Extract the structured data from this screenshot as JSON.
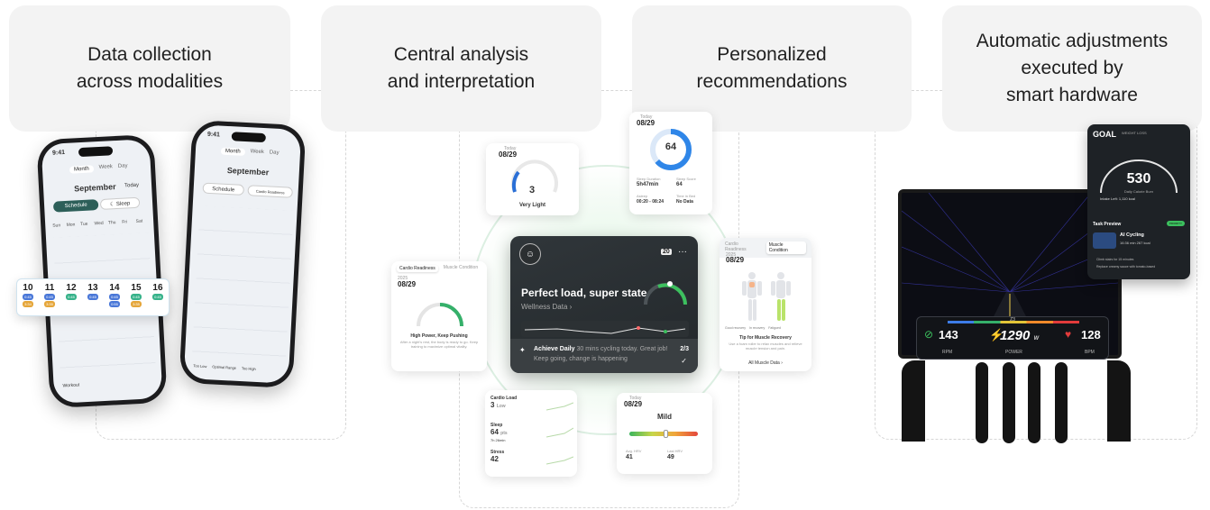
{
  "stages": [
    {
      "line1": "Data collection",
      "line2": "across modalities",
      "line3": ""
    },
    {
      "line1": "Central analysis",
      "line2": "and interpretation",
      "line3": ""
    },
    {
      "line1": "Personalized",
      "line2": "recommendations",
      "line3": ""
    },
    {
      "line1": "Automatic adjustments",
      "line2": "executed by",
      "line3": "smart hardware"
    }
  ],
  "phone_left": {
    "time": "9:41",
    "tabs": [
      "Month",
      "Week",
      "Day"
    ],
    "month": "September",
    "today": "Today",
    "schedule": "Schedule",
    "sleep": "Sleep",
    "days": [
      "Sun",
      "Mon",
      "Tue",
      "Wed",
      "Thu",
      "Fri",
      "Sat"
    ],
    "workout": "Workout"
  },
  "phone_right": {
    "time": "9:41",
    "tabs": [
      "Month",
      "Week",
      "Day"
    ],
    "month": "September",
    "schedule": "Schedule",
    "metric": "Cardio Readiness",
    "legend": [
      "Too Low",
      "Optimal Range",
      "Too High"
    ]
  },
  "week_strip": {
    "days": [
      {
        "num": "10",
        "tag1": "0:45",
        "tag2": "3:34"
      },
      {
        "num": "11",
        "tag1": "0:45",
        "tag2": "3:35"
      },
      {
        "num": "12",
        "tag1": "0:45",
        "tag2": ""
      },
      {
        "num": "13",
        "tag1": "0:45",
        "tag2": ""
      },
      {
        "num": "14",
        "tag1": "0:45",
        "tag2": "0:55"
      },
      {
        "num": "15",
        "tag1": "0:45",
        "tag2": "3:35"
      },
      {
        "num": "16",
        "tag1": "0:45",
        "tag2": ""
      }
    ]
  },
  "card_strain": {
    "date": "08/29",
    "value": "3",
    "label": "Very Light",
    "today": "Today"
  },
  "card_score": {
    "date": "08/29",
    "value": "64",
    "today": "Today",
    "stats": [
      {
        "label": "Sleep Duration",
        "value": "5h47min"
      },
      {
        "label": "Sleep Score",
        "value": "64"
      },
      {
        "label": "Asleep",
        "value": "00:20 - 08:24"
      },
      {
        "label": "Time in Bed",
        "value": "No Data"
      }
    ]
  },
  "card_cardio": {
    "tab1": "Cardio Readiness",
    "tab2": "Muscle Condition",
    "year": "2025",
    "date": "08/29",
    "title": "High Power, Keep Pushing",
    "body": "After a night's rest, the body is ready to go. Keep training to maximize optimal vitality."
  },
  "main_card": {
    "day": "20",
    "headline": "Perfect load, super state",
    "sub": "Wellness Data",
    "goal_title": "Achieve Daily",
    "goal_text": "30 mins cycling today. Great job!",
    "goal_sub": "Keep going, change is happening",
    "count": "2/3"
  },
  "card_metrics": {
    "rows": [
      {
        "label": "Cardio Load",
        "value": "3",
        "unit": "Low"
      },
      {
        "label": "Sleep",
        "value": "64",
        "unit": "pts"
      },
      {
        "label": "Stress",
        "value": "42",
        "unit": ""
      }
    ],
    "sleep_extra": "7h 26min"
  },
  "card_stress": {
    "date": "08/29",
    "today": "Today",
    "value": "Mild",
    "stat1_label": "Avg. HRV",
    "stat1_value": "41",
    "stat2_label": "Last HRV",
    "stat2_value": "49"
  },
  "card_muscle": {
    "tab1": "Cardio Readiness",
    "tab2": "Muscle Condition",
    "year": "2025",
    "date": "08/29",
    "legend": [
      "Good recovery",
      "In recovery",
      "Fatigued"
    ],
    "title": "Tip for Muscle Recovery",
    "body": "Use a foam roller to relax muscles and relieve muscle tension and pain.",
    "link": "All Muscle Data"
  },
  "bike": {
    "zone": "Z3",
    "rpm": "143",
    "rpm_unit": "RPM",
    "power": "1290",
    "power_w": "W",
    "power_unit": "POWER",
    "bpm": "128",
    "bpm_unit": "BPM"
  },
  "goal_panel": {
    "title": "GOAL",
    "subtitle": "WEIGHT LOSS",
    "calories": "530",
    "cal_label": "Daily Calorie Burn",
    "intake": "Intake Left: 1,110 kcal",
    "task": "Task Preview",
    "badge": "PRIORITY",
    "activity": "AI Cycling",
    "stats": "16:36 min   267 kcal",
    "tip1": "Climb stairs for 15 minutes",
    "tip2": "Replace creamy sauce with tomato-based"
  },
  "colors": {
    "accent_green": "#2fb35a",
    "accent_blue": "#2f7de0",
    "card_bg": "#f3f3f3",
    "power_orange": "#f0a020",
    "heart_red": "#e23b3b"
  }
}
